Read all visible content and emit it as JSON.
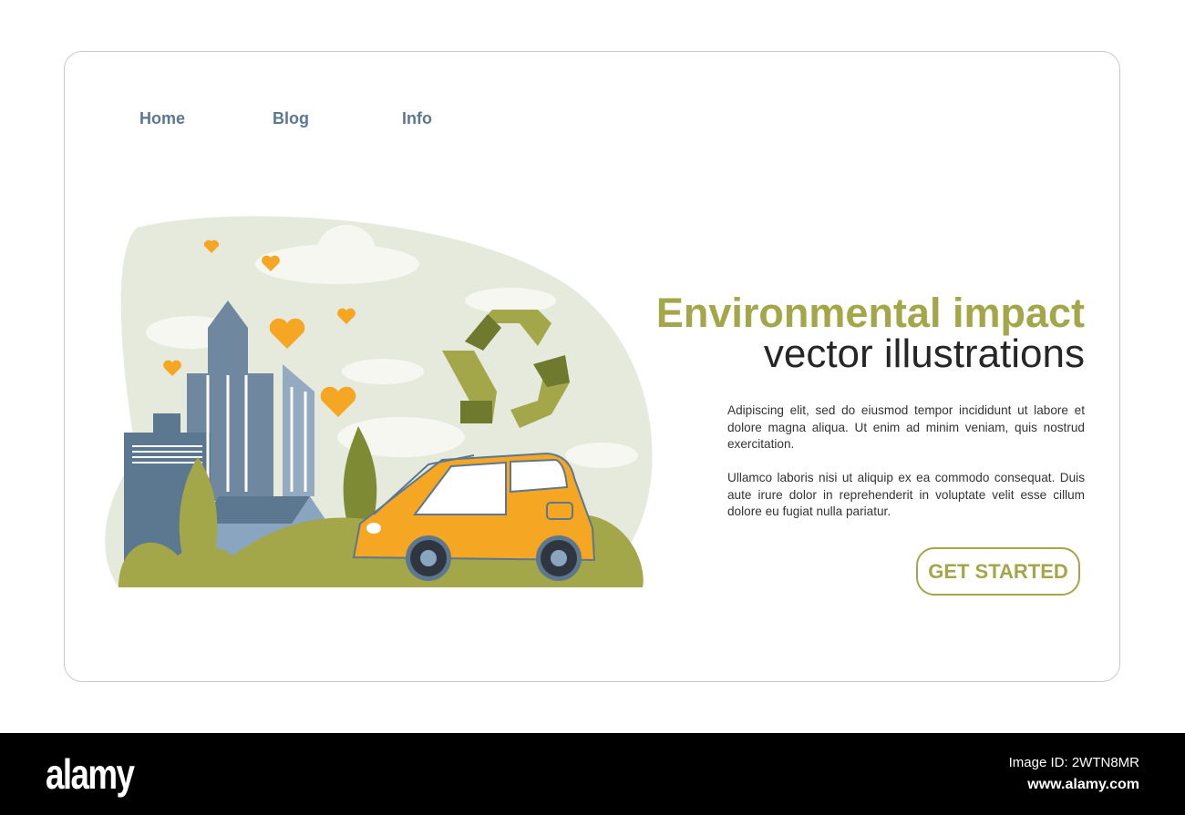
{
  "nav": {
    "items": [
      "Home",
      "Blog",
      "Info"
    ]
  },
  "hero": {
    "title_line1": "Environmental impact",
    "title_line2": "vector illustrations",
    "paragraphs": [
      "Adipiscing elit, sed do eiusmod tempor incididunt ut labore et dolore magna aliqua. Ut enim ad minim veniam, quis nostrud exercitation.",
      "Ullamco laboris nisi ut aliquip ex ea commodo consequat. Duis aute irure dolor in reprehenderit in voluptate velit esse cillum dolore eu fugiat nulla pariatur."
    ],
    "cta_label": "GET STARTED"
  },
  "colors": {
    "accent": "#a3a649",
    "nav": "#5b7890",
    "car": "#f5a623",
    "building": "#6f88a0"
  },
  "footer": {
    "logo": "alamy",
    "image_id": "Image ID: 2WTN8MR",
    "url": "www.alamy.com"
  }
}
